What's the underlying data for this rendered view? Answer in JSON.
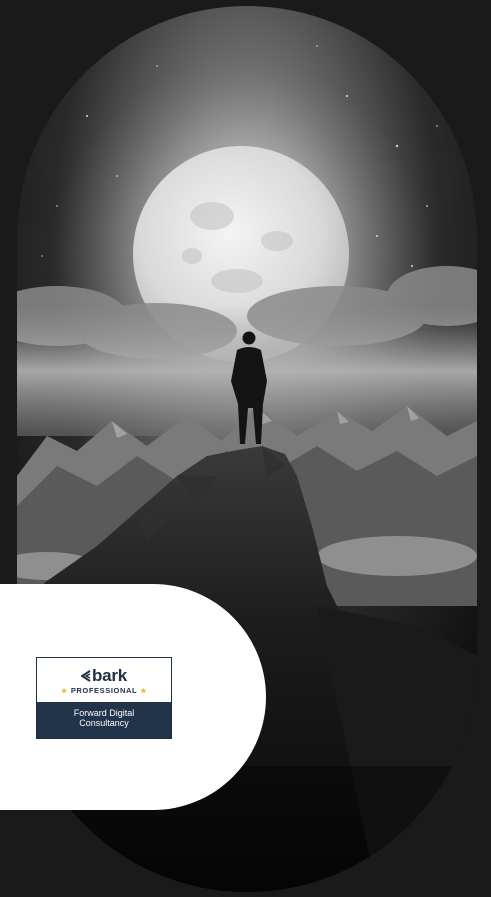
{
  "hero": {
    "image_description_icon": "mountain-moon-hero-image"
  },
  "badge": {
    "logo_text": "bark",
    "subtitle": "PROFESSIONAL",
    "business_name_line1": "Forward Digital",
    "business_name_line2": "Consultancy",
    "brand_color": "#21344a",
    "star_color": "#e9b43b"
  }
}
